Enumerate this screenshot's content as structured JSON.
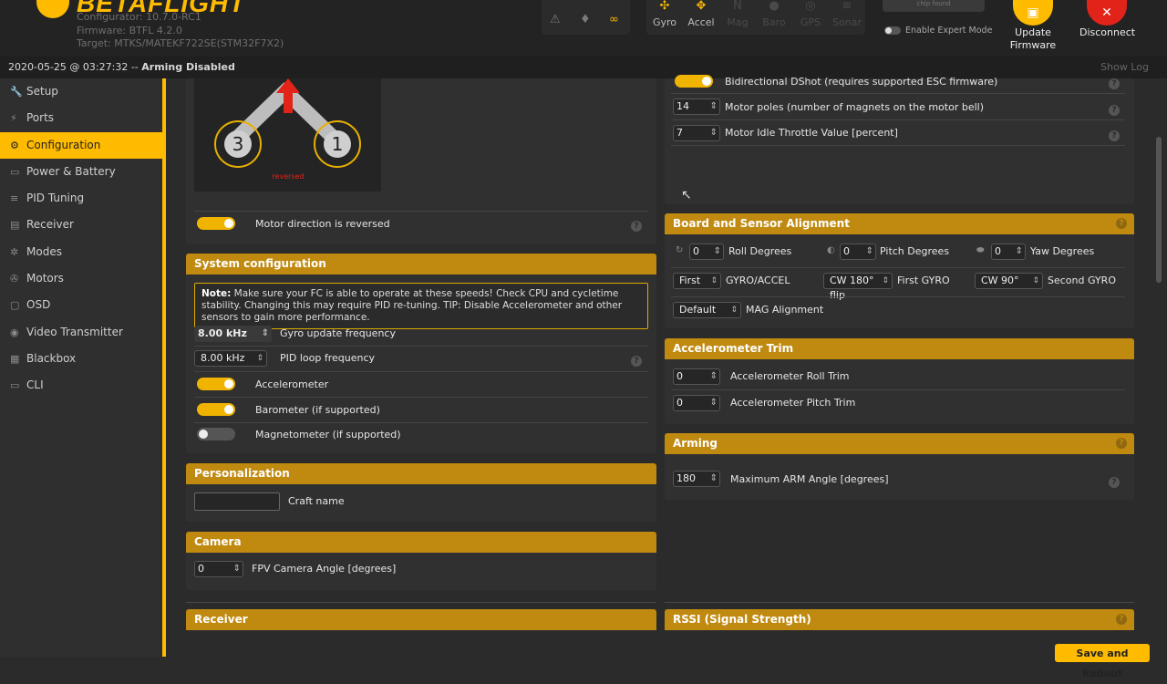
{
  "header": {
    "logo": "BETAFLIGHT",
    "configurator": "Configurator: 10.7.0-RC1",
    "firmware": "Firmware: BTFL 4.2.0",
    "target": "Target: MTKS/MATEKF722SE(STM32F7X2)",
    "sensors": [
      {
        "label": "Gyro",
        "icon": "gyro-icon",
        "active": true
      },
      {
        "label": "Accel",
        "icon": "accel-icon",
        "active": true
      },
      {
        "label": "Mag",
        "icon": "mag-icon",
        "active": false
      },
      {
        "label": "Baro",
        "icon": "baro-icon",
        "active": false
      },
      {
        "label": "GPS",
        "icon": "gps-icon",
        "active": false
      },
      {
        "label": "Sonar",
        "icon": "sonar-icon",
        "active": false
      }
    ],
    "chip": "chip found",
    "expert_mode": "Enable Expert Mode",
    "update_firmware": "Update Firmware",
    "disconnect": "Disconnect",
    "accent": "#ffbb00",
    "disconnect_color": "#e2231a"
  },
  "status": {
    "time": "2020-05-25 @ 03:27:32 -- ",
    "state": "Arming Disabled",
    "show_log": "Show Log"
  },
  "sidebar": {
    "items": [
      {
        "label": "Setup",
        "icon": "wrench-icon"
      },
      {
        "label": "Ports",
        "icon": "plug-icon"
      },
      {
        "label": "Configuration",
        "icon": "gear-icon",
        "active": true
      },
      {
        "label": "Power & Battery",
        "icon": "battery-icon"
      },
      {
        "label": "PID Tuning",
        "icon": "sliders-icon"
      },
      {
        "label": "Receiver",
        "icon": "receiver-icon"
      },
      {
        "label": "Modes",
        "icon": "modes-icon"
      },
      {
        "label": "Motors",
        "icon": "motor-icon"
      },
      {
        "label": "OSD",
        "icon": "osd-icon"
      },
      {
        "label": "Video Transmitter",
        "icon": "vtx-icon"
      },
      {
        "label": "Blackbox",
        "icon": "blackbox-icon"
      },
      {
        "label": "CLI",
        "icon": "terminal-icon"
      }
    ]
  },
  "motor_direction": {
    "motor3": "3",
    "motor1": "1",
    "reversed_caption": "reversed",
    "toggle_label": "Motor direction is reversed",
    "toggle_on": true
  },
  "system_config": {
    "title": "System configuration",
    "note_bold": "Note:",
    "note_text": " Make sure your FC is able to operate at these speeds! Check CPU and cycletime stability. Changing this may require PID re-tuning. TIP: Disable Accelerometer and other sensors to gain more performance.",
    "gyro_freq_value": "8.00 kHz",
    "gyro_freq_label": "Gyro update frequency",
    "pid_loop_value": "8.00 kHz",
    "pid_loop_label": "PID loop frequency",
    "accelerometer": "Accelerometer",
    "barometer": "Barometer (if supported)",
    "magnetometer": "Magnetometer (if supported)"
  },
  "personalization": {
    "title": "Personalization",
    "craft_name_label": "Craft name",
    "craft_name_value": ""
  },
  "camera": {
    "title": "Camera",
    "angle_value": "0",
    "angle_label": "FPV Camera Angle [degrees]"
  },
  "receiver": {
    "title": "Receiver"
  },
  "esc": {
    "bidir_label": "Bidirectional DShot (requires supported ESC firmware)",
    "poles_value": "14",
    "poles_label": "Motor poles (number of magnets on the motor bell)",
    "idle_value": "7",
    "idle_label": "Motor Idle Throttle Value [percent]"
  },
  "alignment": {
    "title": "Board and Sensor Alignment",
    "roll_value": "0",
    "roll_label": "Roll Degrees",
    "pitch_value": "0",
    "pitch_label": "Pitch Degrees",
    "yaw_value": "0",
    "yaw_label": "Yaw Degrees",
    "gyro_sel": "First",
    "gyro_label": "GYRO/ACCEL",
    "first_gyro_sel": "CW 180° flip",
    "first_gyro_label": "First GYRO",
    "second_gyro_sel": "CW 90°",
    "second_gyro_label": "Second GYRO",
    "mag_sel": "Default",
    "mag_label": "MAG Alignment"
  },
  "acc_trim": {
    "title": "Accelerometer Trim",
    "roll_value": "0",
    "roll_label": "Accelerometer Roll Trim",
    "pitch_value": "0",
    "pitch_label": "Accelerometer Pitch Trim"
  },
  "arming": {
    "title": "Arming",
    "angle_value": "180",
    "angle_label": "Maximum ARM Angle [degrees]"
  },
  "rssi": {
    "title": "RSSI (Signal Strength)"
  },
  "save_button": "Save and Reboot"
}
